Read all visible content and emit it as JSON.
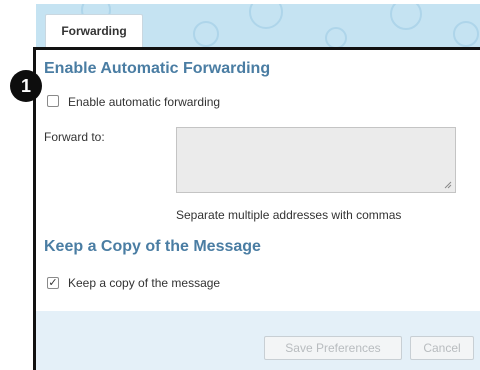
{
  "tab": {
    "label": "Forwarding"
  },
  "step_badge": "1",
  "forwarding_section": {
    "heading": "Enable Automatic Forwarding",
    "checkbox_label": "Enable automatic forwarding",
    "checked": false,
    "forward_to_label": "Forward to:",
    "forward_to_value": "",
    "hint": "Separate multiple addresses with commas"
  },
  "copy_section": {
    "heading": "Keep a Copy of the Message",
    "checkbox_label": "Keep a copy of the message",
    "checked": true,
    "check_glyph": "✓"
  },
  "buttons": {
    "save": "Save Preferences",
    "cancel": "Cancel"
  },
  "colors": {
    "heading": "#4a7da3",
    "banner": "#c5e3f2",
    "footer": "#e4f0f8",
    "textarea": "#ebebeb"
  }
}
